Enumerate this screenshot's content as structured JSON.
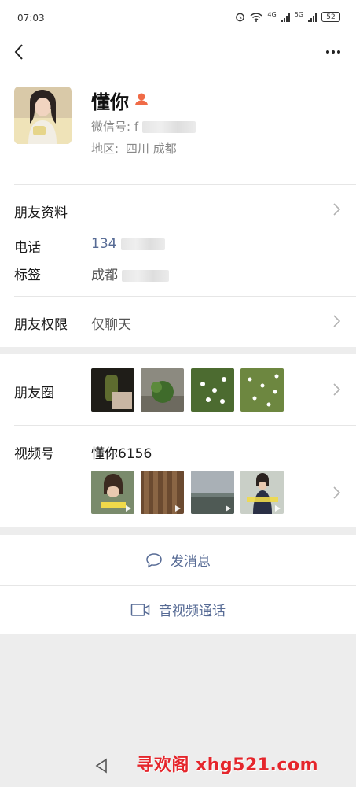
{
  "status": {
    "time": "07:03",
    "net1": "4G",
    "net2": "5G",
    "battery": "52"
  },
  "profile": {
    "name": "懂你",
    "wechat_id_label": "微信号: f",
    "region_label": "地区:",
    "region_value": "四川  成都"
  },
  "info": {
    "friend_info": "朋友资料",
    "phone_label": "电话",
    "phone_value": "134",
    "tags_label": "标签",
    "tags_value": "成都",
    "permission_label": "朋友权限",
    "permission_value": "仅聊天"
  },
  "moments": {
    "label": "朋友圈"
  },
  "channels": {
    "label": "视频号",
    "account": "懂你6156"
  },
  "actions": {
    "message": "发消息",
    "call": "音视频通话"
  },
  "watermark": "寻欢阁 xhg521.com",
  "colors": {
    "link": "#576b95",
    "gender": "#f06b47",
    "watermark": "#e5262c"
  }
}
